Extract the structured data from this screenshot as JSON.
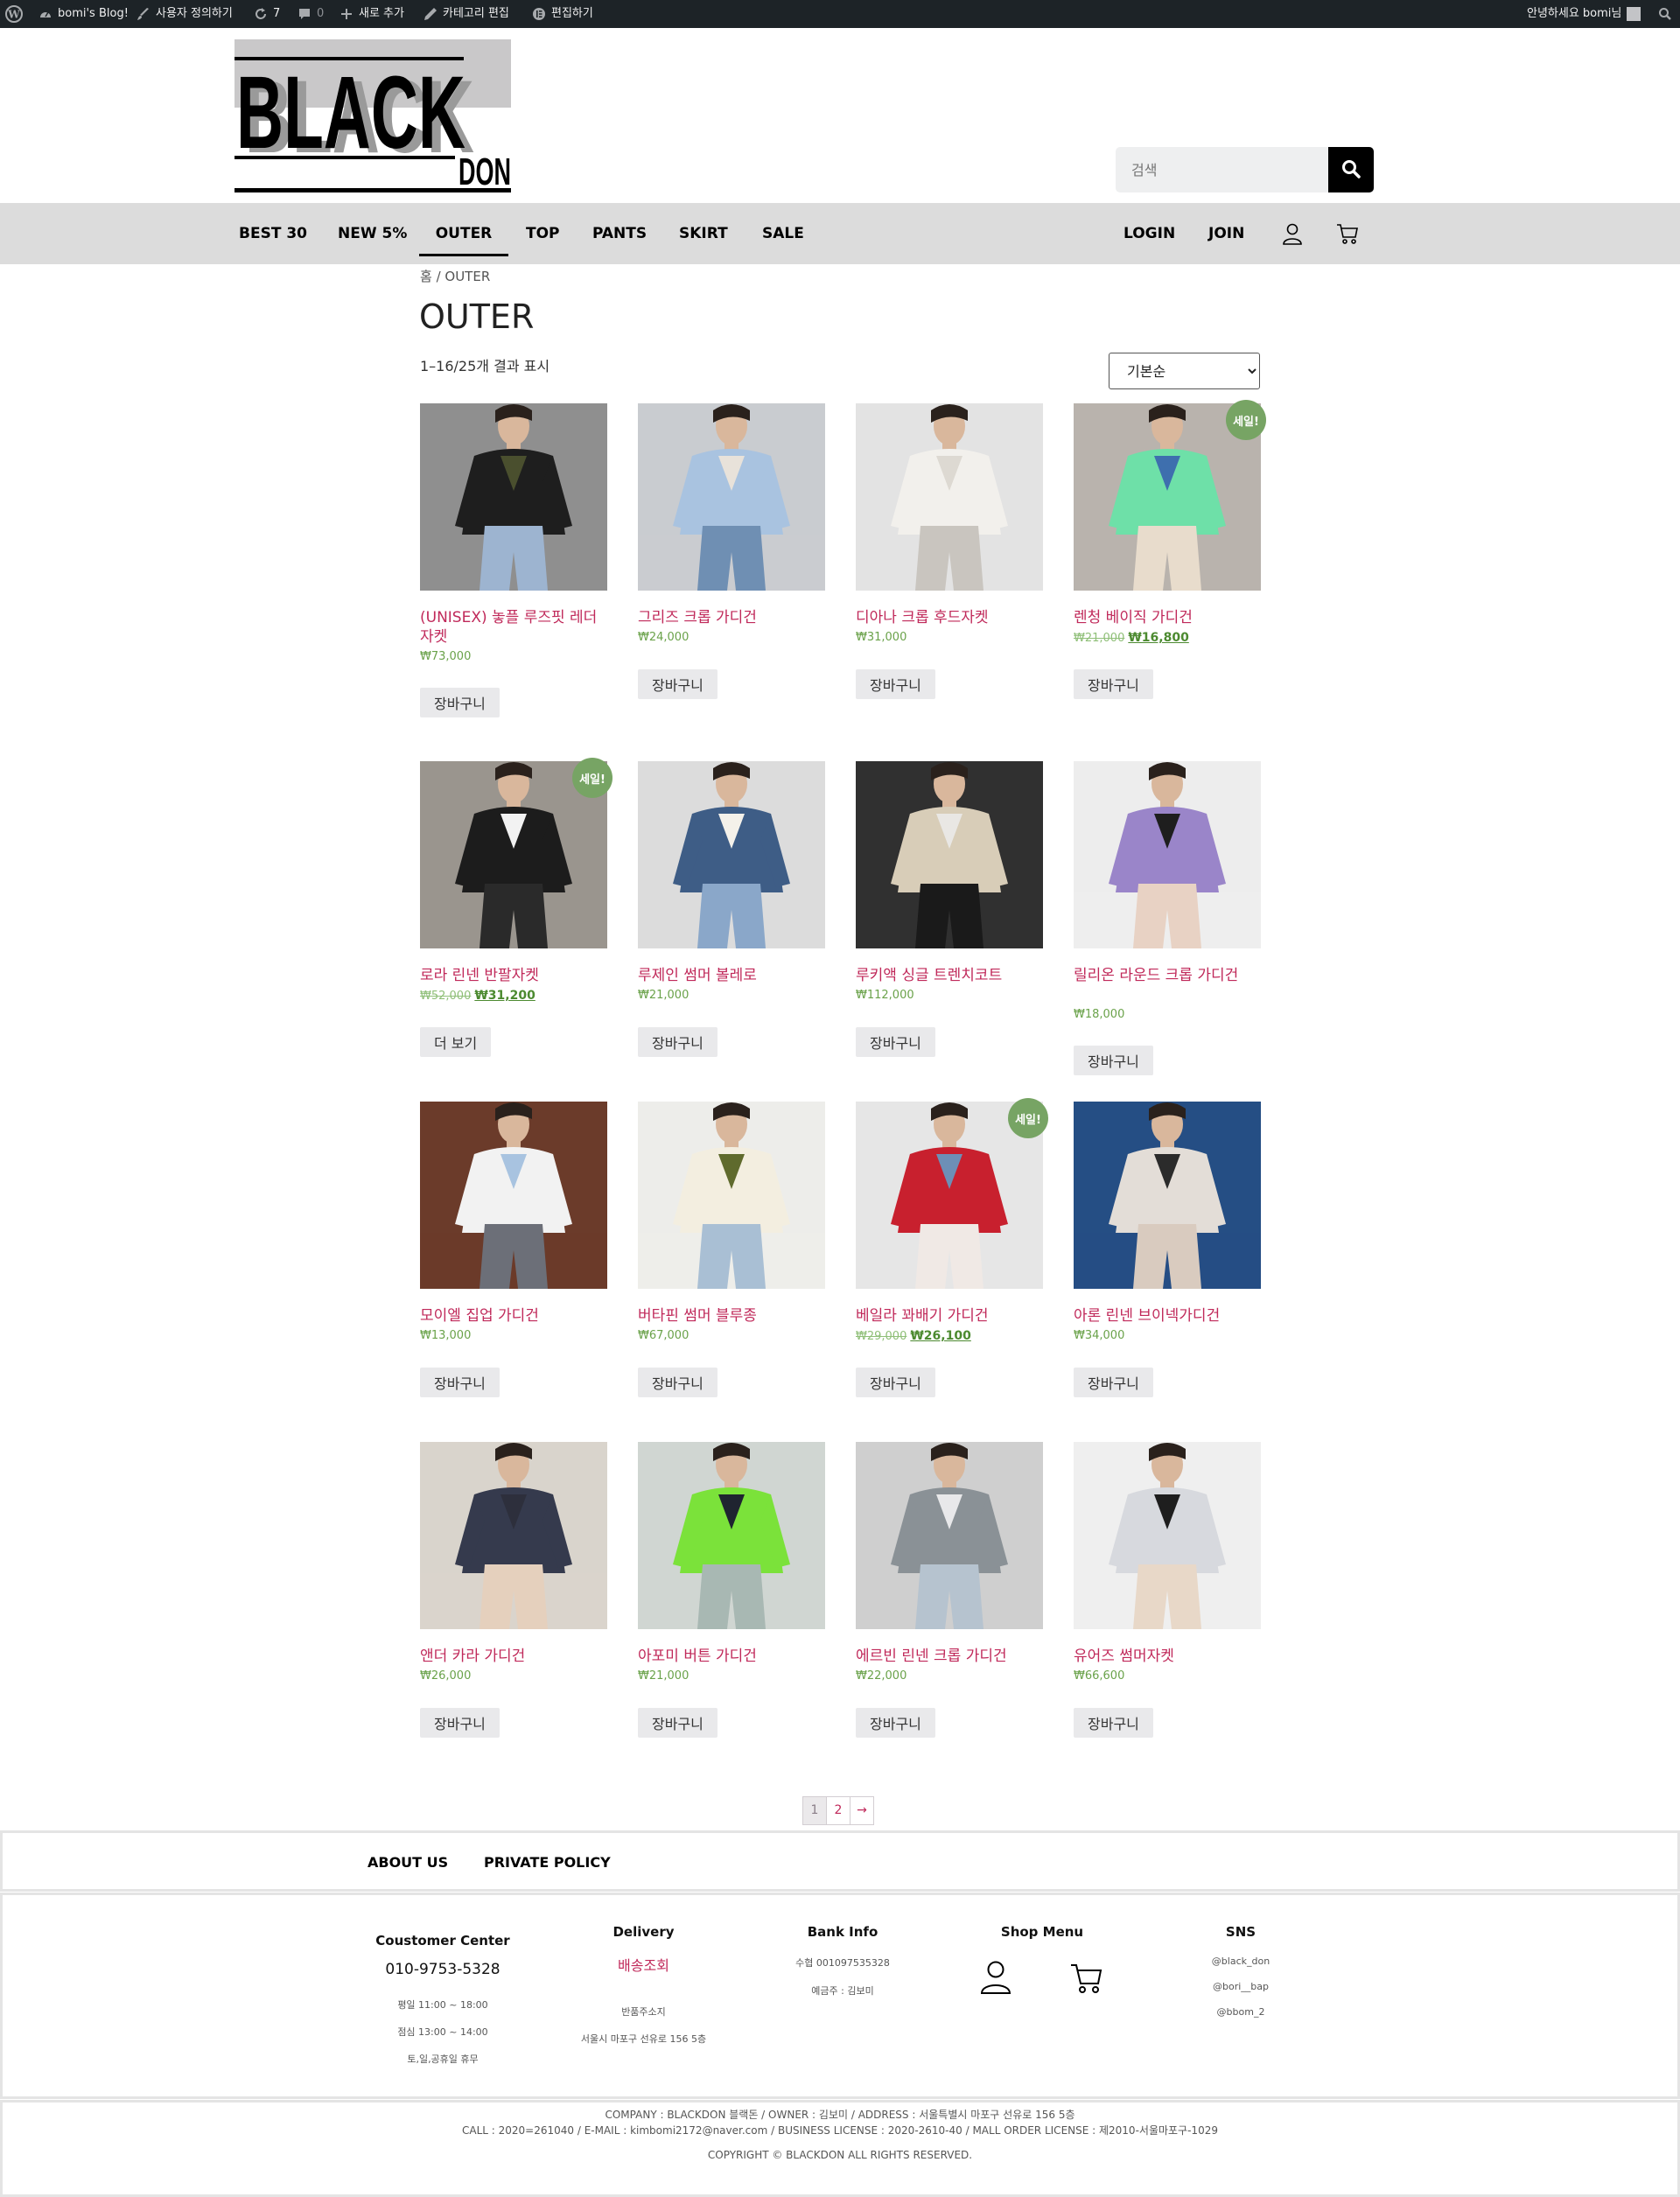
{
  "adminbar": {
    "blog": "bomi's Blog!",
    "customize": "사용자 정의하기",
    "updates": "7",
    "comments": "0",
    "new": "새로 추가",
    "edit_category": "카테고리 편집",
    "edit": "편집하기",
    "greeting": "안녕하세요 bomi님"
  },
  "logo": {
    "big": "BLACK",
    "small": "DON"
  },
  "search": {
    "placeholder": "검색"
  },
  "nav": {
    "left": [
      "BEST 30",
      "NEW 5%",
      "OUTER",
      "TOP",
      "PANTS",
      "SKIRT",
      "SALE"
    ],
    "active": "OUTER",
    "login": "LOGIN",
    "join": "JOIN"
  },
  "breadcrumb": "홈 / OUTER",
  "title": "OUTER",
  "result_count": "1–16/25개 결과 표시",
  "orderby": "기본순",
  "products": [
    {
      "name": "(UNISEX) 놓플 루즈핏 레더자켓",
      "price": "₩73,000",
      "btn": "장바구니",
      "img": "leather"
    },
    {
      "name": "그리즈 크롭 가디건",
      "price": "₩24,000",
      "btn": "장바구니",
      "img": "bluecard"
    },
    {
      "name": "디아나 크롭 후드자켓",
      "price": "₩31,000",
      "btn": "장바구니",
      "img": "whitehood"
    },
    {
      "name": "렌청 베이직 가디건",
      "old": "₩21,000",
      "price": "₩16,800",
      "sale": "세일!",
      "btn": "장바구니",
      "img": "mint"
    },
    {
      "name": "로라 린넨 반팔자켓",
      "old": "₩52,000",
      "price": "₩31,200",
      "sale": "세일!",
      "btn": "더 보기",
      "img": "blackjacket"
    },
    {
      "name": "루제인 썸머 볼레로",
      "price": "₩21,000",
      "btn": "장바구니",
      "img": "bolero"
    },
    {
      "name": "루키액 싱글 트렌치코트",
      "price": "₩112,000",
      "btn": "장바구니",
      "img": "trench"
    },
    {
      "name": "릴리온 라운드 크롭 가디건",
      "price": "₩18,000",
      "btn": "장바구니",
      "img": "purple"
    },
    {
      "name": "모이엘 집업 가디건",
      "price": "₩13,000",
      "btn": "장바구니",
      "img": "zipup"
    },
    {
      "name": "버타핀 썸머 블루종",
      "price": "₩67,000",
      "btn": "장바구니",
      "img": "cream"
    },
    {
      "name": "베일라 꽈배기 가디건",
      "old": "₩29,000",
      "price": "₩26,100",
      "sale": "세일!",
      "btn": "장바구니",
      "img": "red"
    },
    {
      "name": "아론 린넨 브이넥가디건",
      "price": "₩34,000",
      "btn": "장바구니",
      "img": "vneck"
    },
    {
      "name": "앤더 카라 가디건",
      "price": "₩26,000",
      "btn": "장바구니",
      "img": "navy"
    },
    {
      "name": "아포미 버튼 가디건",
      "price": "₩21,000",
      "btn": "장바구니",
      "img": "green"
    },
    {
      "name": "에르빈 린넨 크롭 가디건",
      "price": "₩22,000",
      "btn": "장바구니",
      "img": "grey"
    },
    {
      "name": "유어즈 썸머자켓",
      "price": "₩66,600",
      "btn": "장바구니",
      "img": "lightjacket"
    }
  ],
  "pagination": [
    "1",
    "2",
    "→"
  ],
  "footer_nav": [
    "ABOUT US",
    "PRIVATE POLICY"
  ],
  "footer": {
    "customer": {
      "title": "Coustomer Center",
      "phone": "010-9753-5328",
      "hours": [
        "평일 11:00 ~ 18:00",
        "점심 13:00 ~ 14:00",
        "토,일,공휴일 휴무"
      ]
    },
    "delivery": {
      "title": "Delivery",
      "link": "배송조회",
      "lines": [
        "반품주소지",
        "서울시 마포구 선유로 156 5층"
      ]
    },
    "bank": {
      "title": "Bank Info",
      "lines": [
        "수협  001097535328",
        "예금주 : 김보미"
      ]
    },
    "shop": {
      "title": "Shop Menu"
    },
    "sns": {
      "title": "SNS",
      "lines": [
        "@black_don",
        "@bori__bap",
        "@bbom_2"
      ]
    }
  },
  "copyright": {
    "line1": "COMPANY : BLACKDON 블랙돈 / OWNER : 김보미 / ADDRESS :  서울특별시 마포구 선유로 156 5층",
    "line2": "CALL : 2020=261040 / E-MAIL : kimbomi2172@naver.com / BUSINESS LICENSE : 2020-2610-40 / MALL ORDER LICENSE : 제2010-서울마포구-1029",
    "line3": "COPYRIGHT © BLACKDON ALL RIGHTS RESERVED."
  }
}
